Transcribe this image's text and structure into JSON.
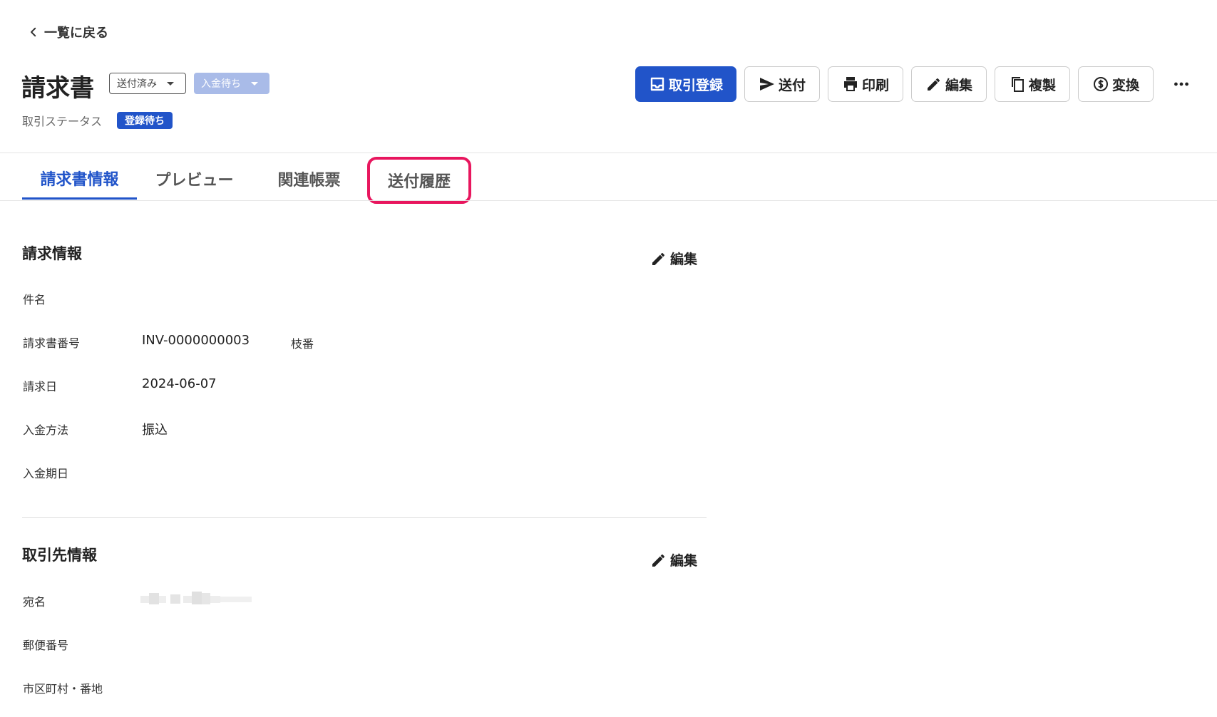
{
  "nav": {
    "back_label": "一覧に戻る"
  },
  "header": {
    "title": "請求書",
    "send_status": "送付済み",
    "payment_status": "入金待ち",
    "transaction_status_label": "取引ステータス",
    "transaction_status": "登録待ち"
  },
  "actions": {
    "register": "取引登録",
    "send": "送付",
    "print": "印刷",
    "edit": "編集",
    "duplicate": "複製",
    "convert": "変換"
  },
  "tabs": [
    "請求書情報",
    "プレビュー",
    "関連帳票",
    "送付履歴"
  ],
  "billing": {
    "title": "請求情報",
    "edit_label": "編集",
    "subject_label": "件名",
    "number_label": "請求書番号",
    "number_value": "INV-0000000003",
    "branch_label": "枝番",
    "date_label": "請求日",
    "date_value": "2024-06-07",
    "method_label": "入金方法",
    "method_value": "振込",
    "due_label": "入金期日"
  },
  "client": {
    "title": "取引先情報",
    "edit_label": "編集",
    "name_label": "宛名",
    "postal_label": "郵便番号",
    "address_label": "市区町村・番地"
  },
  "colors": {
    "primary": "#2154c9",
    "highlight": "#e8165e",
    "chip_wait": "#a9bbe8"
  }
}
